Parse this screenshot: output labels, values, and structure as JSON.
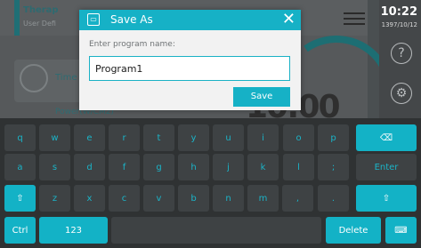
{
  "background": {
    "therapy": "Therap",
    "user_defined": "User Defi",
    "time_label": "Time",
    "power_label": "Power(W/CM2)",
    "big_value": "10:00",
    "clock_time": "10:22",
    "clock_date": "1397/10/12",
    "help_glyph": "?",
    "gear_glyph": "⚙"
  },
  "dialog": {
    "title": "Save As",
    "close_glyph": "✕",
    "prompt": "Enter program name:",
    "input_value": "Program1",
    "save_label": "Save"
  },
  "keyboard": {
    "row1": [
      "q",
      "w",
      "e",
      "r",
      "t",
      "y",
      "u",
      "i",
      "o",
      "p"
    ],
    "row1_backspace": "⌫",
    "row2": [
      "a",
      "s",
      "d",
      "f",
      "g",
      "h",
      "j",
      "k",
      "l",
      ";"
    ],
    "row2_enter": "Enter",
    "row3_shift_left": "⇧",
    "row3": [
      "z",
      "x",
      "c",
      "v",
      "b",
      "n",
      "m",
      ",",
      ".",
      "?"
    ],
    "row3_shift_right": "⇧",
    "row4_ctrl": "Ctrl",
    "row4_123": "123",
    "row4_delete": "Delete",
    "row4_hide": "⌨"
  }
}
